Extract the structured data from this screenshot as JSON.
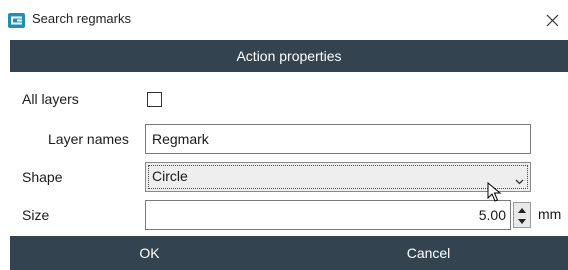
{
  "window": {
    "title": "Search regmarks",
    "app_icon": "app-logo-icon",
    "close_icon": "close-icon"
  },
  "section": {
    "title": "Action properties"
  },
  "form": {
    "all_layers_label": "All layers",
    "all_layers_checked": false,
    "layer_names_label": "Layer names",
    "layer_names_value": "Regmark",
    "shape_label": "Shape",
    "shape_value": "Circle",
    "size_label": "Size",
    "size_value": "5.00",
    "size_unit": "mm"
  },
  "buttons": {
    "ok": "OK",
    "cancel": "Cancel"
  },
  "colors": {
    "header_bg": "#334350",
    "accent": "#1e8fb5"
  }
}
